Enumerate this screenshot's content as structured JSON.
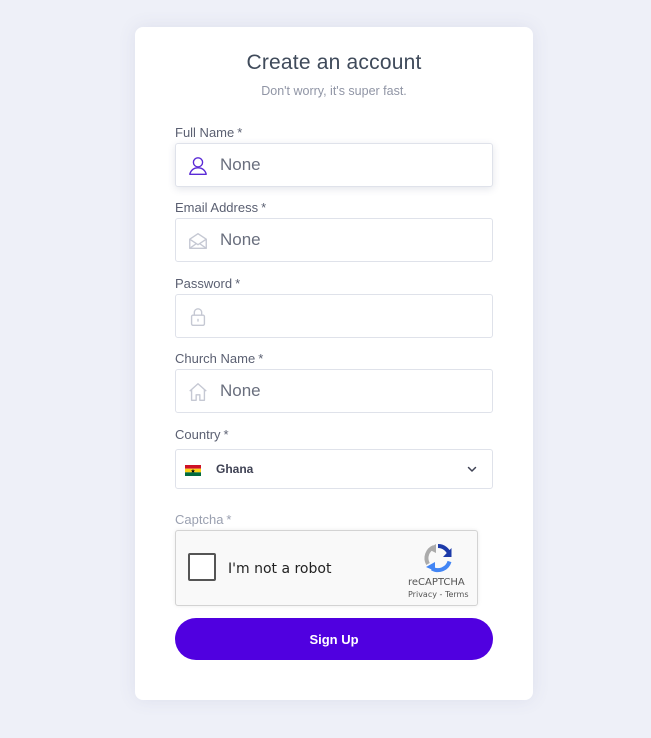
{
  "form": {
    "title": "Create an account",
    "subtitle": "Don't worry, it's super fast.",
    "required_mark": "*",
    "full_name": {
      "label": "Full Name",
      "placeholder": "None",
      "icon": "user-icon"
    },
    "email": {
      "label": "Email Address",
      "placeholder": "None",
      "icon": "envelope-icon"
    },
    "password": {
      "label": "Password",
      "placeholder": "",
      "icon": "lock-icon"
    },
    "church_name": {
      "label": "Church Name",
      "placeholder": "None",
      "icon": "home-icon"
    },
    "country": {
      "label": "Country",
      "selected": "Ghana",
      "flag": "ghana-flag-icon",
      "icon": "chevron-down-icon"
    },
    "captcha": {
      "label": "Captcha",
      "checkbox_text": "I'm not a robot",
      "brand": "reCAPTCHA",
      "links": "Privacy - Terms"
    },
    "submit_label": "Sign Up"
  },
  "colors": {
    "page_bg": "#eef0f8",
    "accent": "#5000e0",
    "active_icon": "#5a2ad6",
    "muted_icon": "#c5c8d3"
  }
}
